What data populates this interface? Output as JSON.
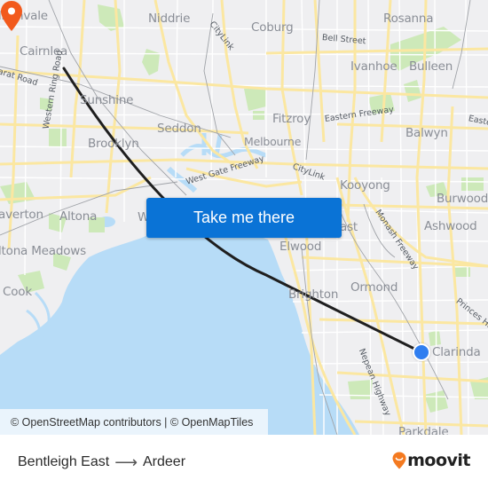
{
  "map": {
    "attribution": "© OpenStreetMap contributors | © OpenMapTiles",
    "cta_label": "Take me there",
    "colors": {
      "land": "#efeff1",
      "water": "#b7dcf7",
      "road_major": "#fbe7a1",
      "road_minor": "#ffffff",
      "park": "#cde9b9",
      "route_line": "#1f1f1f",
      "button": "#0a73d6",
      "origin": "#2f7ef0",
      "destination": "#f25a1d"
    },
    "suburbs": [
      {
        "name": "lbanvale"
      },
      {
        "name": "Cairnlea"
      },
      {
        "name": "Niddrie"
      },
      {
        "name": "Coburg"
      },
      {
        "name": "Rosanna"
      },
      {
        "name": "Ivanhoe"
      },
      {
        "name": "Bulleen"
      },
      {
        "name": "Sunshine"
      },
      {
        "name": "Fitzroy"
      },
      {
        "name": "Seddon"
      },
      {
        "name": "Melbourne"
      },
      {
        "name": "Balwyn"
      },
      {
        "name": "Brooklyn"
      },
      {
        "name": "Kooyong"
      },
      {
        "name": "Burwood"
      },
      {
        "name": "averton"
      },
      {
        "name": "Altona"
      },
      {
        "name": "W"
      },
      {
        "name": "ast"
      },
      {
        "name": "Ashwood"
      },
      {
        "name": "ltona Meadows"
      },
      {
        "name": "Elwood"
      },
      {
        "name": "Ormond"
      },
      {
        "name": "Cook"
      },
      {
        "name": "Brighton"
      },
      {
        "name": "Clarinda"
      },
      {
        "name": "Parkdale"
      }
    ],
    "roads": [
      {
        "name": "CityLink"
      },
      {
        "name": "Bell Street"
      },
      {
        "name": "arat Road"
      },
      {
        "name": "Western Ring Road"
      },
      {
        "name": "Eastern Freeway"
      },
      {
        "name": "Easte"
      },
      {
        "name": "West Gate Freeway"
      },
      {
        "name": "CityLink"
      },
      {
        "name": "Monash Freeway"
      },
      {
        "name": "Princes Hi"
      },
      {
        "name": "Nepean Highway"
      }
    ],
    "origin_marker": "Bentleigh East",
    "destination_marker": "Ardeer"
  },
  "footer": {
    "origin": "Bentleigh East",
    "destination": "Ardeer",
    "arrow": "⟶",
    "brand": "moovit"
  }
}
